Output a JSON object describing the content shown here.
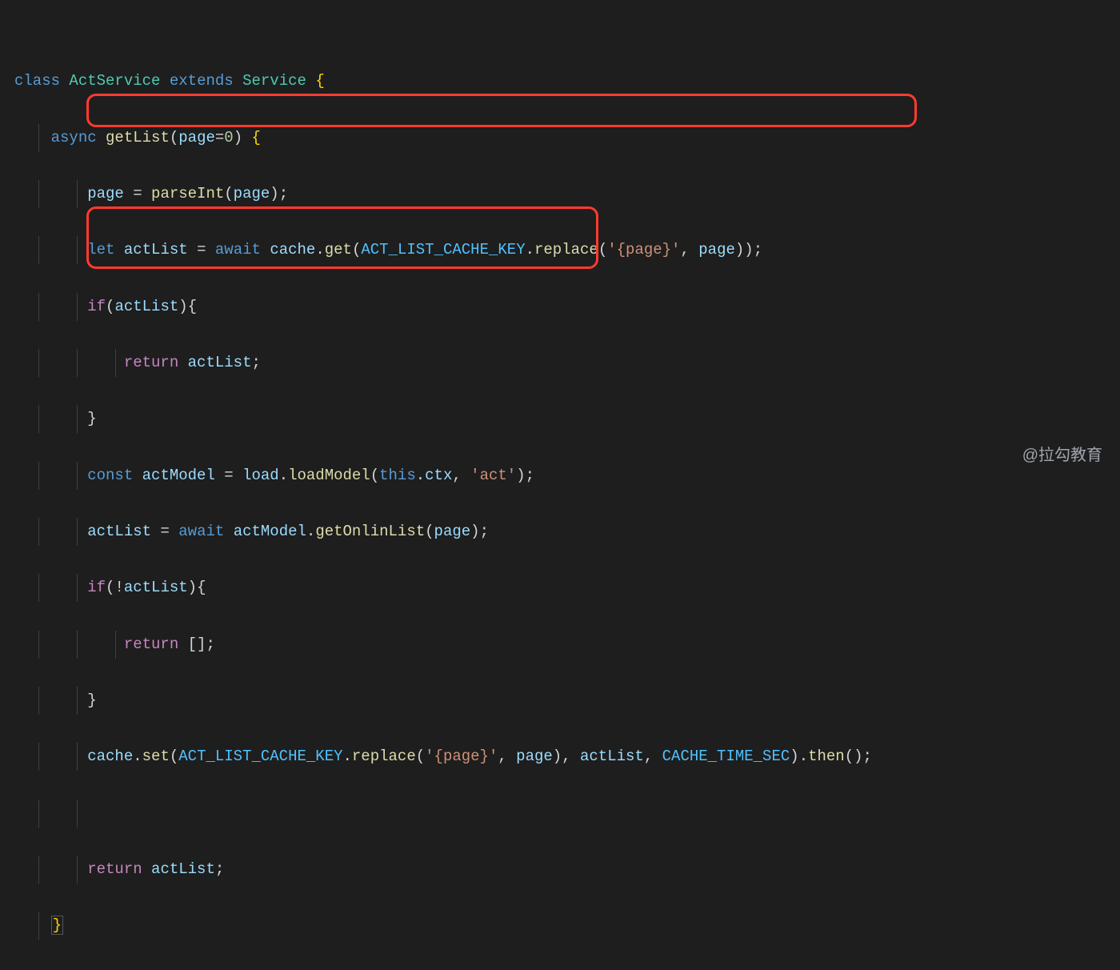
{
  "code": {
    "l1": {
      "class_kw": "class",
      "cls1": "ActService",
      "extends_kw": "extends",
      "cls2": "Service",
      "brace": "{"
    },
    "l2": {
      "async": "async",
      "fn": "getList",
      "lp": "(",
      "param": "page",
      "eq": "=",
      "zero": "0",
      "rp": ")",
      "brace": "{"
    },
    "l3": {
      "v": "page",
      "eq": " = ",
      "fn": "parseInt",
      "lp": "(",
      "arg": "page",
      "rp": ")",
      ";": ";"
    },
    "l4": {
      "let": "let",
      "v": "actList",
      "eq": " = ",
      "await": "await",
      "obj": "cache",
      "dot": ".",
      "fn": "get",
      "lp": "(",
      "c": "ACT_LIST_CACHE_KEY",
      "dot2": ".",
      "fn2": "replace",
      "lp2": "(",
      "s1": "'{page}'",
      "comma": ", ",
      "arg": "page",
      "rp2": ")",
      "rp": ")",
      ";": ";"
    },
    "l5": {
      "if": "if",
      "lp": "(",
      "v": "actList",
      "rp": ")",
      "brace": "{"
    },
    "l6": {
      "return": "return",
      "v": "actList",
      ";": ";"
    },
    "l7": {
      "brace": "}"
    },
    "l8": {
      "const": "const",
      "v": "actModel",
      "eq": " = ",
      "obj": "load",
      "dot": ".",
      "fn": "loadModel",
      "lp": "(",
      "this": "this",
      "dot2": ".",
      "prop": "ctx",
      "comma": ", ",
      "s": "'act'",
      "rp": ")",
      ";": ";"
    },
    "l9": {
      "v": "actList",
      "eq": " = ",
      "await": "await",
      "obj": "actModel",
      "dot": ".",
      "fn": "getOnlinList",
      "lp": "(",
      "arg": "page",
      "rp": ")",
      ";": ";"
    },
    "l10": {
      "if": "if",
      "lp": "(",
      "bang": "!",
      "v": "actList",
      "rp": ")",
      "brace": "{"
    },
    "l11": {
      "return": "return",
      "arr": "[]",
      ";": ";"
    },
    "l12": {
      "brace": "}"
    },
    "l13": {
      "obj": "cache",
      "dot": ".",
      "fn": "set",
      "lp": "(",
      "c": "ACT_LIST_CACHE_KEY",
      "dot2": ".",
      "fn2": "replace",
      "lp2": "(",
      "s1": "'{page}'",
      "comma": ", ",
      "arg": "page",
      "rp2": ")",
      "comma2": ", ",
      "v": "actList",
      "comma3": ", ",
      "c2": "CACHE_TIME_SEC",
      "rp": ")",
      "dot3": ".",
      "fn3": "then",
      "lp3": "(",
      "rp3": ")",
      ";": ";"
    },
    "l15": {
      "return": "return",
      "v": "actList",
      ";": ";"
    },
    "l16": {
      "brace": "}"
    }
  },
  "watermark": "@拉勾教育"
}
